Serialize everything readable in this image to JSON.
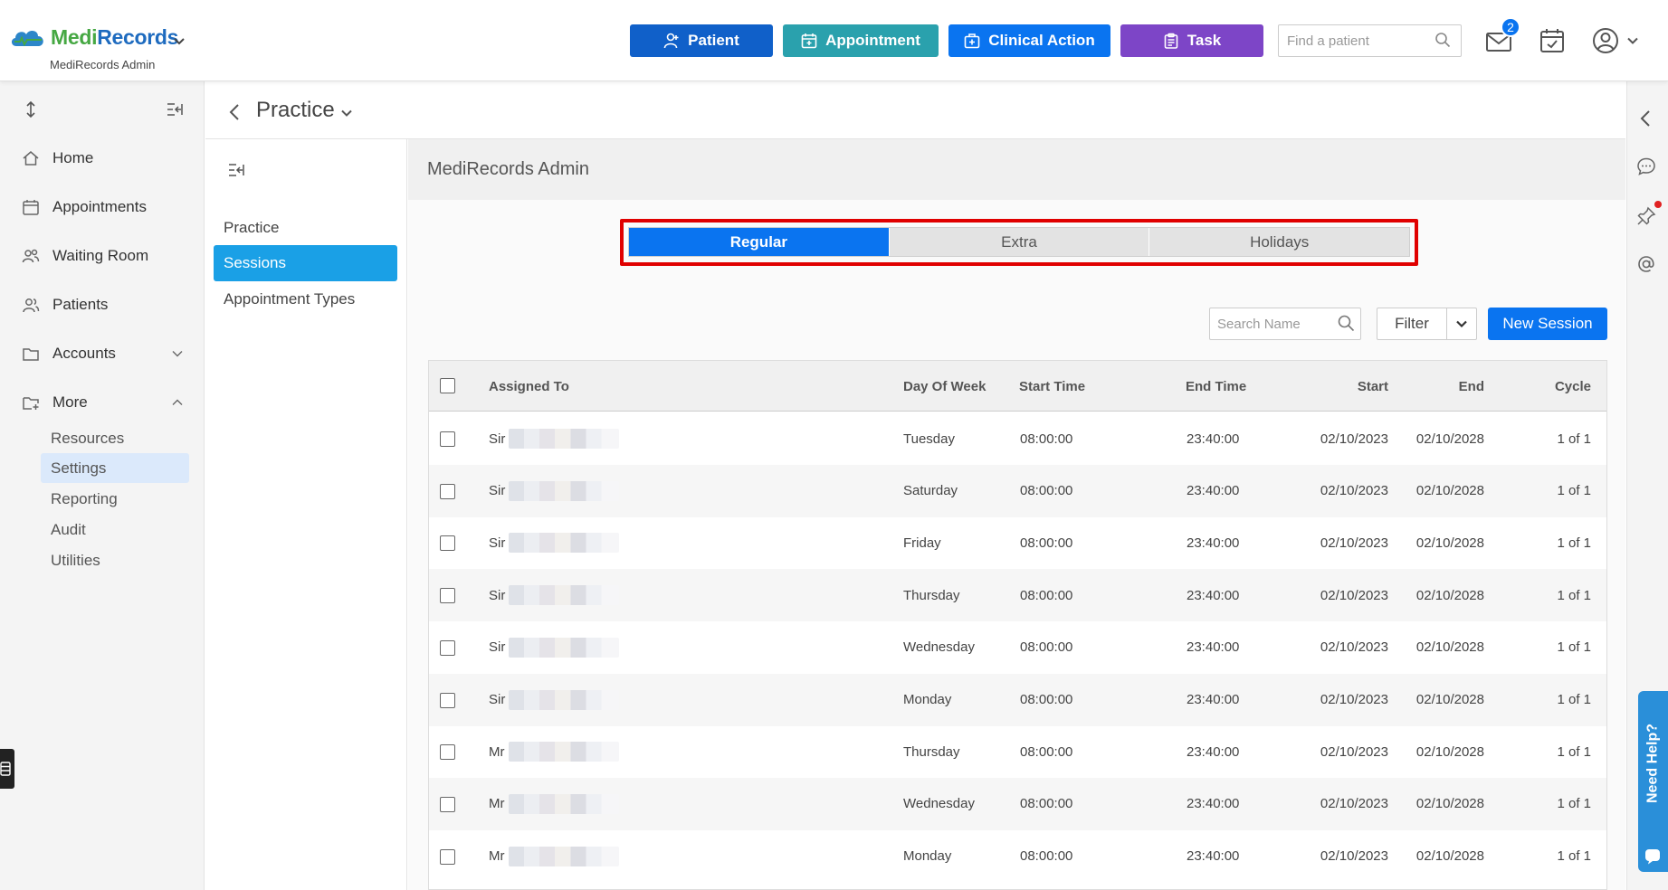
{
  "app": {
    "brand_part1": "Medi",
    "brand_part2": "Records",
    "subtitle": "MediRecords Admin"
  },
  "header": {
    "buttons": {
      "patient": "Patient",
      "appointment": "Appointment",
      "clinical_action": "Clinical Action",
      "task": "Task"
    },
    "search_placeholder": "Find a patient",
    "mail_badge": "2"
  },
  "sidebar": {
    "items": {
      "home": "Home",
      "appointments": "Appointments",
      "waiting_room": "Waiting Room",
      "patients": "Patients",
      "accounts": "Accounts",
      "more": "More"
    },
    "more_subitems": [
      "Resources",
      "Settings",
      "Reporting",
      "Audit",
      "Utilities"
    ],
    "active_subitem": "Settings"
  },
  "page": {
    "title": "Practice"
  },
  "settings_nav": [
    "Practice",
    "Sessions",
    "Appointment Types"
  ],
  "content": {
    "title": "MediRecords Admin",
    "tabs": [
      "Regular",
      "Extra",
      "Holidays"
    ],
    "search_placeholder": "Search Name",
    "filter_label": "Filter",
    "new_session_label": "New Session"
  },
  "table": {
    "columns": {
      "assigned_to": "Assigned To",
      "day_of_week": "Day Of Week",
      "start_time": "Start Time",
      "end_time": "End Time",
      "start": "Start",
      "end": "End",
      "cycle": "Cycle"
    },
    "rows": [
      {
        "title": "Sir",
        "day": "Tuesday",
        "start_time": "08:00:00",
        "end_time": "23:40:00",
        "start": "02/10/2023",
        "end": "02/10/2028",
        "cycle": "1 of 1"
      },
      {
        "title": "Sir",
        "day": "Saturday",
        "start_time": "08:00:00",
        "end_time": "23:40:00",
        "start": "02/10/2023",
        "end": "02/10/2028",
        "cycle": "1 of 1"
      },
      {
        "title": "Sir",
        "day": "Friday",
        "start_time": "08:00:00",
        "end_time": "23:40:00",
        "start": "02/10/2023",
        "end": "02/10/2028",
        "cycle": "1 of 1"
      },
      {
        "title": "Sir",
        "day": "Thursday",
        "start_time": "08:00:00",
        "end_time": "23:40:00",
        "start": "02/10/2023",
        "end": "02/10/2028",
        "cycle": "1 of 1"
      },
      {
        "title": "Sir",
        "day": "Wednesday",
        "start_time": "08:00:00",
        "end_time": "23:40:00",
        "start": "02/10/2023",
        "end": "02/10/2028",
        "cycle": "1 of 1"
      },
      {
        "title": "Sir",
        "day": "Monday",
        "start_time": "08:00:00",
        "end_time": "23:40:00",
        "start": "02/10/2023",
        "end": "02/10/2028",
        "cycle": "1 of 1"
      },
      {
        "title": "Mr",
        "day": "Thursday",
        "start_time": "08:00:00",
        "end_time": "23:40:00",
        "start": "02/10/2023",
        "end": "02/10/2028",
        "cycle": "1 of 1"
      },
      {
        "title": "Mr",
        "day": "Wednesday",
        "start_time": "08:00:00",
        "end_time": "23:40:00",
        "start": "02/10/2023",
        "end": "02/10/2028",
        "cycle": "1 of 1"
      },
      {
        "title": "Mr",
        "day": "Monday",
        "start_time": "08:00:00",
        "end_time": "23:40:00",
        "start": "02/10/2023",
        "end": "02/10/2028",
        "cycle": "1 of 1"
      }
    ]
  },
  "right_rail": {
    "need_help": "Need Help?"
  },
  "colors": {
    "primary": "#0a74f0",
    "patient_button": "#1060c9",
    "appointment_button": "#2aa1ad",
    "task_button": "#7d45c7",
    "active_nav": "#1aa0e6",
    "highlight_outline": "#e00000"
  },
  "icons": {
    "patient": "user-plus-icon",
    "appointment": "calendar-plus-icon",
    "clinical_action": "medical-bag-icon",
    "task": "clipboard-icon",
    "search": "search-icon",
    "mail": "mail-icon",
    "calendar": "calendar-check-icon",
    "user": "user-circle-icon"
  }
}
